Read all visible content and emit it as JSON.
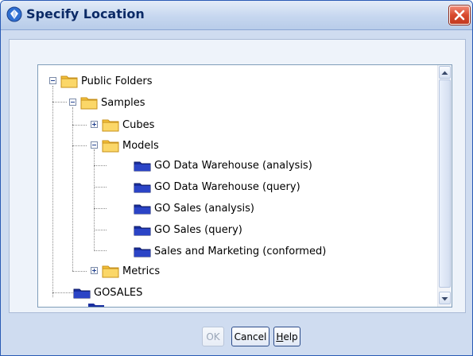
{
  "window": {
    "title": "Specify Location"
  },
  "tree": {
    "items": [
      {
        "label": "Public Folders",
        "type": "folder"
      },
      {
        "label": "Samples",
        "type": "folder"
      },
      {
        "label": "Cubes",
        "type": "folder"
      },
      {
        "label": "Models",
        "type": "folder"
      },
      {
        "label": "GO Data Warehouse (analysis)",
        "type": "package"
      },
      {
        "label": "GO Data Warehouse (query)",
        "type": "package"
      },
      {
        "label": "GO Sales (analysis)",
        "type": "package"
      },
      {
        "label": "GO Sales (query)",
        "type": "package"
      },
      {
        "label": "Sales and Marketing (conformed)",
        "type": "package"
      },
      {
        "label": "Metrics",
        "type": "folder"
      },
      {
        "label": "GOSALES",
        "type": "package"
      }
    ]
  },
  "buttons": {
    "ok": "OK",
    "cancel": "Cancel",
    "help": "Help"
  },
  "colors": {
    "folder": "#f5c23a",
    "package": "#1a2fa0",
    "title": "#0b2a66",
    "close": "#d8492d"
  }
}
